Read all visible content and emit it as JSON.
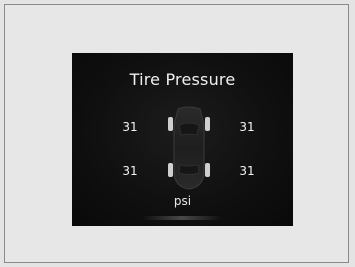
{
  "screen": {
    "title": "Tire Pressure",
    "unit": "psi"
  },
  "tires": {
    "front_left": "31",
    "front_right": "31",
    "rear_left": "31",
    "rear_right": "31"
  },
  "icons": {
    "vehicle": "car-top-view-icon"
  },
  "colors": {
    "panel_bg": "#101010",
    "text": "#f0f0f0",
    "page_bg": "#e7e7e7"
  }
}
